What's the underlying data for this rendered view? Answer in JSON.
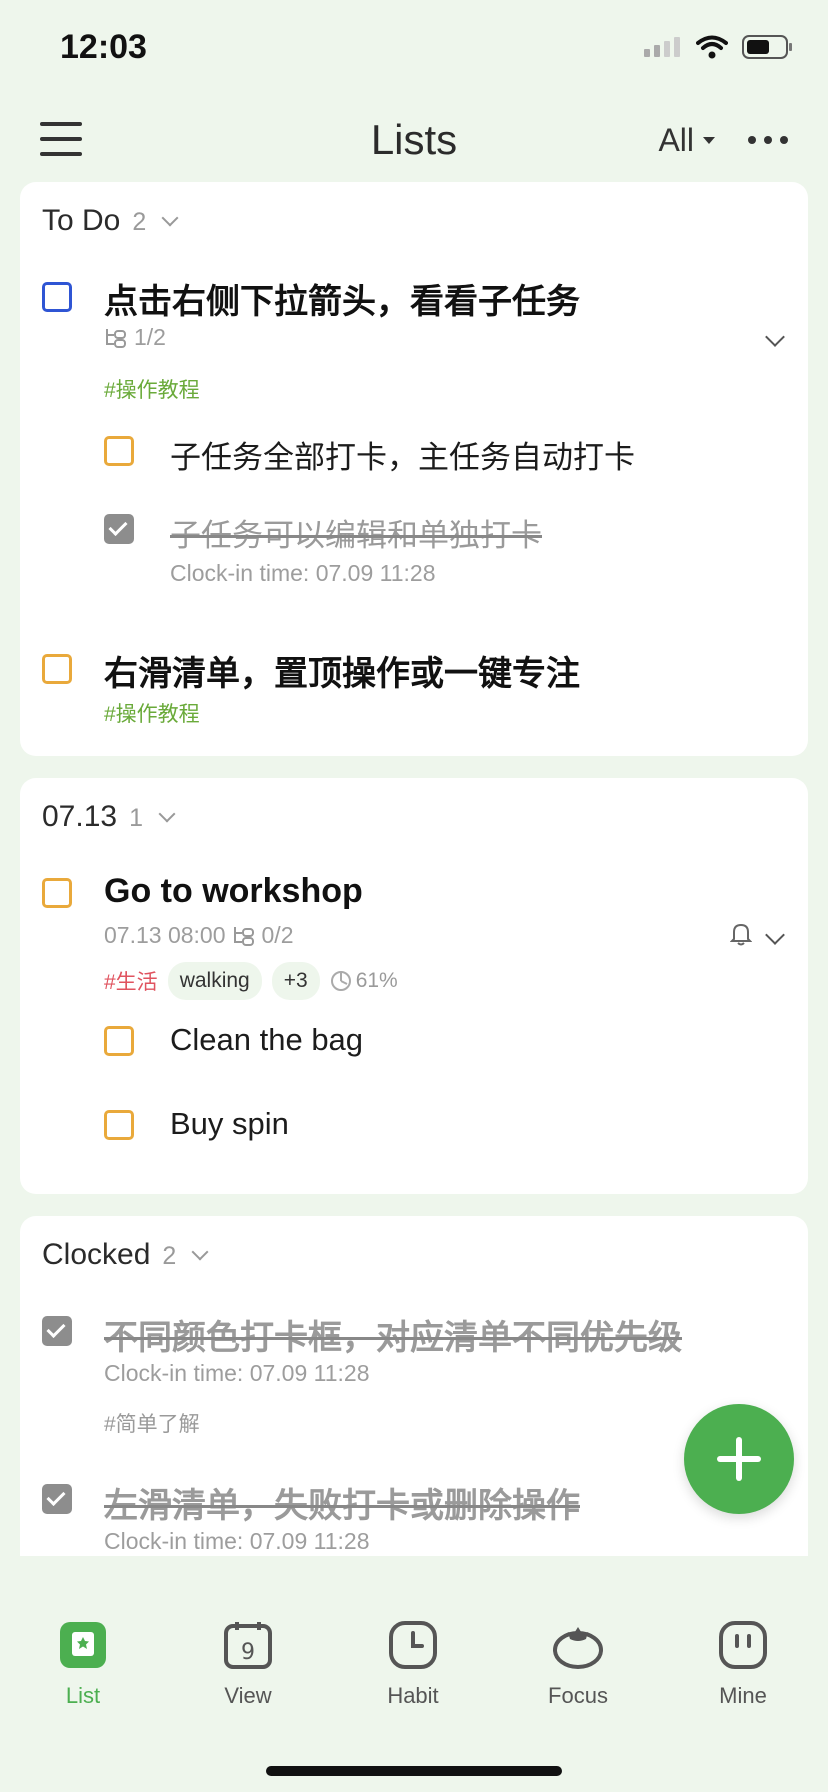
{
  "status_bar": {
    "time": "12:03"
  },
  "header": {
    "title": "Lists",
    "filter_label": "All"
  },
  "sections": {
    "todo": {
      "title": "To Do",
      "count": "2"
    },
    "date": {
      "title": "07.13",
      "count": "1"
    },
    "clocked": {
      "title": "Clocked",
      "count": "2"
    }
  },
  "todo_tasks": [
    {
      "title": "点击右侧下拉箭头，看看子任务",
      "subtask_progress": "1/2",
      "tag": "#操作教程",
      "subtasks": [
        {
          "title": "子任务全部打卡，主任务自动打卡"
        },
        {
          "title": "子任务可以编辑和单独打卡",
          "meta": "Clock-in time: 07.09 11:28"
        }
      ]
    },
    {
      "title": "右滑清单，置顶操作或一键专注",
      "tag": "#操作教程"
    }
  ],
  "date_tasks": [
    {
      "title": "Go to workshop",
      "datetime": "07.13 08:00",
      "subtask_progress": "0/2",
      "tag": "#生活",
      "pill_1": "walking",
      "pill_2": "+3",
      "progress": "61%",
      "subtasks": [
        {
          "title": "Clean the bag"
        },
        {
          "title": "Buy spin"
        }
      ]
    }
  ],
  "clocked_tasks": [
    {
      "title": "不同颜色打卡框，对应清单不同优先级",
      "meta": "Clock-in time: 07.09 11:28",
      "tag": "#简单了解"
    },
    {
      "title": "左滑清单，失败打卡或删除操作",
      "meta": "Clock-in time: 07.09 11:28"
    }
  ],
  "tabbar": {
    "items": [
      {
        "label": "List",
        "icon": "list-icon",
        "active": true
      },
      {
        "label": "View",
        "icon": "calendar-icon",
        "badge": "9"
      },
      {
        "label": "Habit",
        "icon": "clock-icon"
      },
      {
        "label": "Focus",
        "icon": "tomato-icon"
      },
      {
        "label": "Mine",
        "icon": "face-icon"
      }
    ]
  },
  "colors": {
    "accent": "#4caf50",
    "blue_check": "#2f55d4",
    "orange_check": "#e9a93b",
    "tag_green": "#6aaa3a",
    "tag_red": "#e0535f",
    "bg": "#eef6ec"
  }
}
